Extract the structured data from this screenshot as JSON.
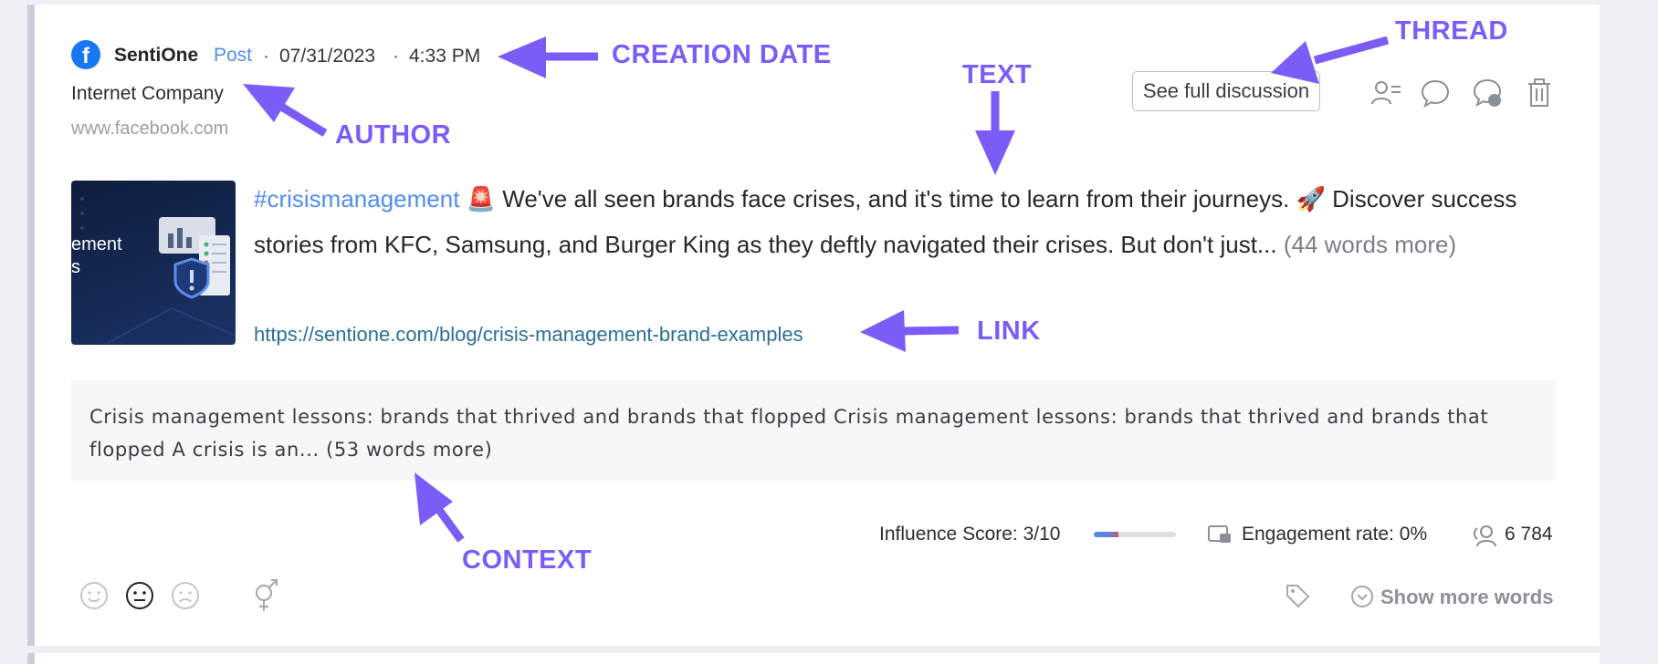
{
  "post": {
    "source_icon": "facebook-icon",
    "author_name": "SentiOne",
    "type": "Post",
    "separator": "·",
    "date": "07/31/2023",
    "time": "4:33 PM",
    "author_description": "Internet Company",
    "author_site": "www.facebook.com",
    "thumbnail_text_line1": "ement",
    "thumbnail_text_line2": "s",
    "hashtag": "#crisismanagement",
    "text_line1": " We've all seen brands face crises, and it's time to learn from their journeys. ",
    "text_rest": "Discover success stories from KFC, Samsung, and Burger King as they deftly navigated their crises. But don't just...",
    "text_more": "(44 words more)",
    "emoji_siren": "🚨",
    "emoji_rocket": "🚀",
    "link": "https://sentione.com/blog/crisis-management-brand-examples"
  },
  "actions": {
    "see_full_discussion": "See full discussion",
    "icons": [
      "author-list-icon",
      "comment-icon",
      "reply-bubble-icon",
      "trash-icon"
    ]
  },
  "context": {
    "text": "Crisis management lessons: brands that thrived and brands that flopped Crisis management lessons: brands that thrived and brands that flopped A crisis is an...",
    "more": "(53 words more)"
  },
  "metrics": {
    "influence_label": "Influence Score: 3/10",
    "influence_fraction": 0.3,
    "engagement_label": "Engagement rate: 0%",
    "reach": "6 784"
  },
  "footer": {
    "sentiment_icons": [
      "positive-face-icon",
      "neutral-face-icon",
      "negative-face-icon"
    ],
    "gender_icon": "gender-icon",
    "tag_icon": "tag-icon",
    "show_more_words": "Show more words"
  },
  "annotations": {
    "creation_date": "CREATION DATE",
    "thread": "THREAD",
    "text": "TEXT",
    "author": "AUTHOR",
    "link": "LINK",
    "context": "CONTEXT"
  },
  "colors": {
    "accent": "#4f8df0",
    "annotation": "#7c5cf7",
    "link": "#2a6f97",
    "card_border": "#c9ceda"
  }
}
